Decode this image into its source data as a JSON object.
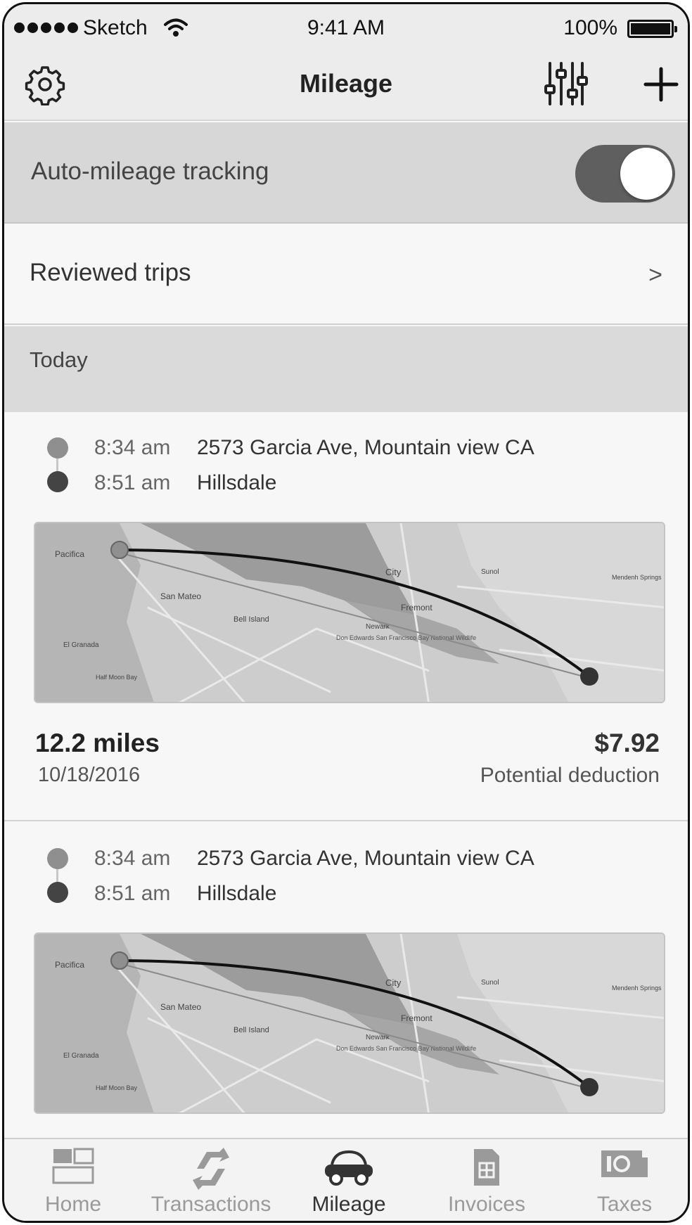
{
  "status_bar": {
    "carrier": "Sketch",
    "time": "9:41 AM",
    "battery": "100%"
  },
  "nav": {
    "title": "Mileage",
    "settings_icon": "gear-icon",
    "filter_icon": "sliders-icon",
    "add_icon": "plus-icon"
  },
  "auto_mileage": {
    "label": "Auto-mileage tracking",
    "enabled": true
  },
  "reviewed_trips": {
    "label": "Reviewed trips",
    "chevron": ">"
  },
  "section": {
    "label": "Today"
  },
  "trips": [
    {
      "start_time": "8:34 am",
      "start_place": "2573 Garcia Ave, Mountain view CA",
      "end_time": "8:51 am",
      "end_place": "Hillsdale",
      "distance": "12.2 miles",
      "date": "10/18/2016",
      "amount": "$7.92",
      "amount_label": "Potential deduction"
    },
    {
      "start_time": "8:34 am",
      "start_place": "2573 Garcia Ave, Mountain view CA",
      "end_time": "8:51 am",
      "end_place": "Hillsdale"
    }
  ],
  "map_labels": {
    "pacifica": "Pacifica",
    "san_mateo": "San Mateo",
    "city": "City",
    "fremont": "Fremont",
    "newark": "Newark",
    "granada": "El Granada",
    "half_moon": "Half Moon Bay",
    "refuge": "Don Edwards San Francisco Bay National Wildlife",
    "mendenhall": "Mendenh Springs",
    "sunol": "Sunol",
    "belmont": "Bell Island"
  },
  "tabs": [
    {
      "label": "Home",
      "icon": "home-grid-icon",
      "active": false
    },
    {
      "label": "Transactions",
      "icon": "transfer-arrows-icon",
      "active": false
    },
    {
      "label": "Mileage",
      "icon": "car-icon",
      "active": true
    },
    {
      "label": "Invoices",
      "icon": "invoice-icon",
      "active": false
    },
    {
      "label": "Taxes",
      "icon": "cash-icon",
      "active": false
    }
  ],
  "colors": {
    "nav_background": "#ececec",
    "toggle_on": "#5f5f5f",
    "section_background": "#dadada",
    "route_line": "#111111"
  }
}
